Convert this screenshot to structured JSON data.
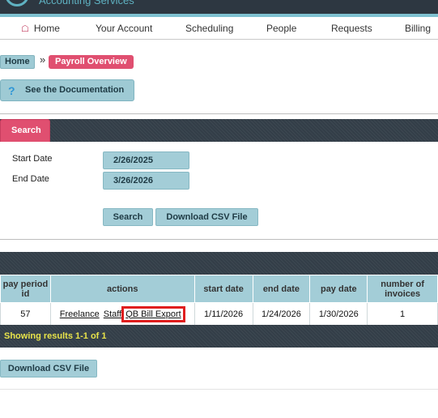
{
  "brand": {
    "name": "Accounting Services"
  },
  "nav": {
    "items": [
      {
        "label": "Home"
      },
      {
        "label": "Your Account"
      },
      {
        "label": "Scheduling"
      },
      {
        "label": "People"
      },
      {
        "label": "Requests"
      },
      {
        "label": "Billing"
      }
    ]
  },
  "breadcrumb": {
    "home": "Home",
    "separator": "»",
    "current": "Payroll Overview"
  },
  "documentation": {
    "label": "See the Documentation"
  },
  "search": {
    "tab_label": "Search",
    "start_label": "Start Date",
    "start_value": "2/26/2025",
    "end_label": "End Date",
    "end_value": "3/26/2026",
    "search_button": "Search",
    "download_button": "Download CSV File"
  },
  "table": {
    "headers": [
      "pay period id",
      "actions",
      "start date",
      "end date",
      "pay date",
      "number of invoices"
    ],
    "rows": [
      {
        "pay_period_id": "57",
        "actions": [
          "Freelance",
          "Staff",
          "QB Bill Export"
        ],
        "start_date": "1/11/2026",
        "end_date": "1/24/2026",
        "pay_date": "1/30/2026",
        "invoices": "1"
      }
    ]
  },
  "results_text": "Showing results 1-1 of 1",
  "download_bottom": "Download CSV File",
  "colors": {
    "accent_pink": "#e04f70",
    "accent_teal": "#a3cdd7",
    "dark_band": "#333e48",
    "highlight_box": "#e01e1e"
  }
}
